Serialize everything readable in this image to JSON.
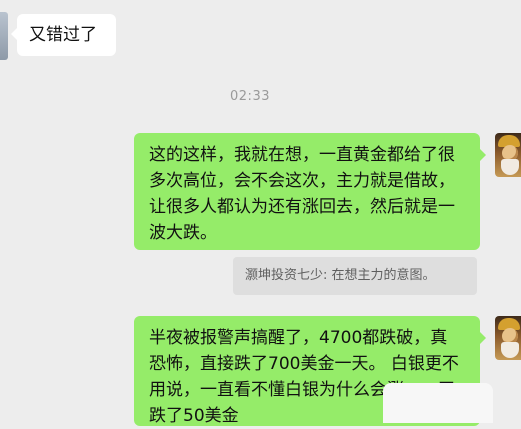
{
  "chat": {
    "messages": [
      {
        "side": "left",
        "lines": [
          "又错过了"
        ]
      },
      {
        "side": "right",
        "lines": [
          "这的这样，我就在想，一直黄金都给了很",
          "多次高位，会不会这次，主力就是借故，",
          "让很多人都认为还有涨回去，然后就是一",
          "波大跌。"
        ]
      },
      {
        "side": "right",
        "lines": [
          "半夜被报警声搞醒了，4700都跌破，真",
          "恐怖，直接跌了700美金一天。 白银更不",
          "用说，一直看不懂白银为什么会涨，一天",
          "跌了50美金"
        ]
      }
    ],
    "timestamp": "02:33",
    "quote": "灏坤投资七少: 在想主力的意图。"
  }
}
